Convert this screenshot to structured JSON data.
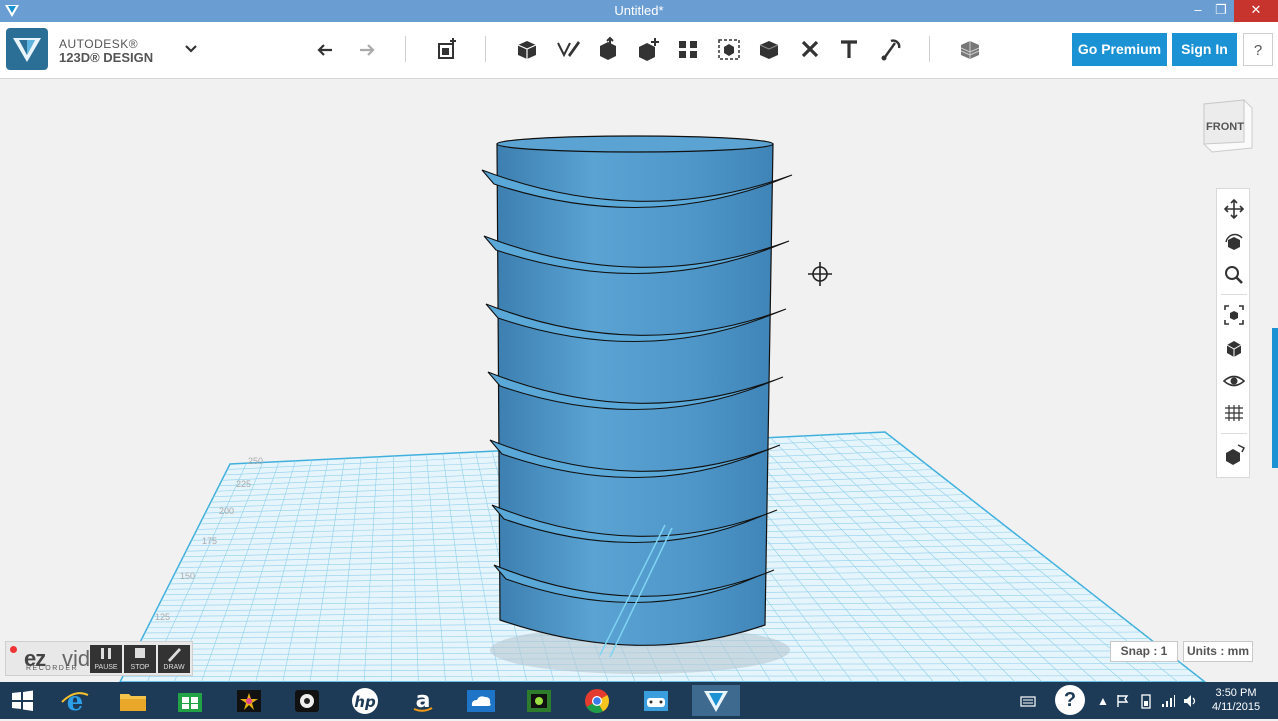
{
  "window": {
    "title": "Untitled*",
    "minimize": "–",
    "restore": "❐",
    "close": "✕"
  },
  "brand": {
    "line1": "AUTODESK®",
    "line2": "123D® DESIGN"
  },
  "toolbar": {
    "tools": [
      "undo-icon",
      "redo-icon",
      "primitives-icon",
      "box-icon",
      "sketch-icon",
      "construct-icon",
      "modify-icon",
      "pattern-icon",
      "group-icon",
      "combine-icon",
      "delete-icon",
      "text-icon",
      "snap-icon",
      "material-icon"
    ]
  },
  "buttons": {
    "go_premium": "Go Premium",
    "sign_in": "Sign In",
    "help": "?"
  },
  "viewcube": {
    "face": "FRONT"
  },
  "grid": {
    "ruler_labels": [
      "250",
      "225",
      "200",
      "175",
      "150",
      "125"
    ]
  },
  "status": {
    "snap": "Snap : 1",
    "units": "Units : mm"
  },
  "recorder": {
    "logo_a": "ez",
    "logo_b": "vid",
    "sub": "RECORDER",
    "pause": "PAUSE",
    "stop": "STOP",
    "draw": "DRAW"
  },
  "taskbar": {
    "time": "3:50 PM",
    "date": "4/11/2015",
    "help": "?",
    "tray_arrow": "▲"
  },
  "colors": {
    "model": "#4f97c9",
    "accent": "#1a92d4",
    "grid": "#7cc6e6",
    "taskbar": "#1d3b57"
  }
}
